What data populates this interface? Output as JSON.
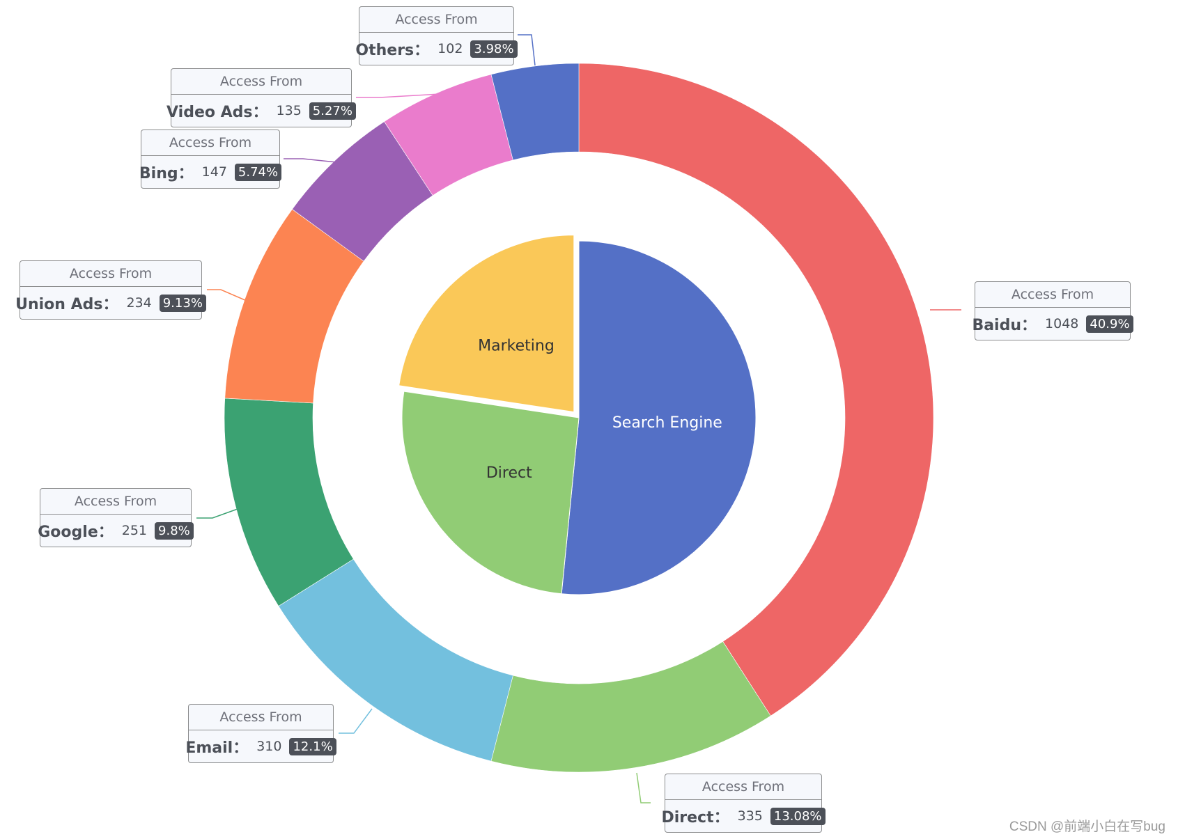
{
  "chart_data": {
    "type": "pie",
    "title": "",
    "series": [
      {
        "name": "Access From",
        "role": "inner-pie",
        "label_position": "inner",
        "selected": "Marketing",
        "data": [
          {
            "name": "Search Engine",
            "value": 1548,
            "color": "#5470c6"
          },
          {
            "name": "Direct",
            "value": 775,
            "color": "#91cc75"
          },
          {
            "name": "Marketing",
            "value": 679,
            "color": "#fac858"
          }
        ]
      },
      {
        "name": "Access From",
        "role": "outer-ring",
        "label_position": "outside",
        "data": [
          {
            "name": "Baidu",
            "value": 1048,
            "percent": "40.9%",
            "color": "#ee6666"
          },
          {
            "name": "Direct",
            "value": 335,
            "percent": "13.08%",
            "color": "#91cc75"
          },
          {
            "name": "Email",
            "value": 310,
            "percent": "12.1%",
            "color": "#73c0de"
          },
          {
            "name": "Google",
            "value": 251,
            "percent": "9.8%",
            "color": "#3ba272"
          },
          {
            "name": "Union Ads",
            "value": 234,
            "percent": "9.13%",
            "color": "#fc8452"
          },
          {
            "name": "Bing",
            "value": 147,
            "percent": "5.74%",
            "color": "#9a60b4"
          },
          {
            "name": "Video Ads",
            "value": 135,
            "percent": "5.27%",
            "color": "#ea7ccc"
          },
          {
            "name": "Others",
            "value": 102,
            "percent": "3.98%",
            "color": "#5470c6"
          }
        ]
      }
    ],
    "label_title": "Access From",
    "label_separator": "："
  },
  "watermark": "CSDN @前端小白在写bug"
}
